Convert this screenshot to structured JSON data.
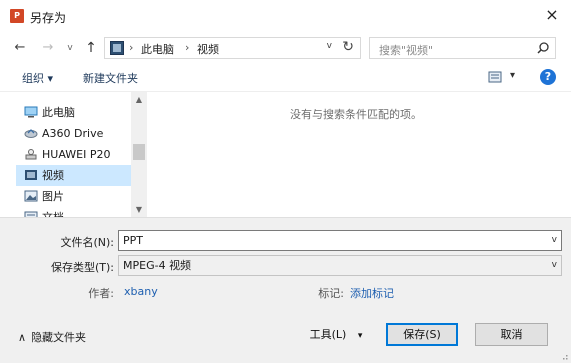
{
  "window": {
    "app_icon_text": "P",
    "title": "另存为",
    "close_glyph": "×"
  },
  "nav": {
    "back_glyph": "←",
    "forward_glyph": "→",
    "recent_glyph": "v",
    "up_glyph": "↑",
    "breadcrumb": [
      "此电脑",
      "视频"
    ],
    "separator": "›",
    "refresh_glyph": "↻",
    "dropdown_glyph": "v"
  },
  "search": {
    "placeholder": "搜索\"视频\""
  },
  "toolbar": {
    "organize_label": "组织 ▾",
    "new_folder_label": "新建文件夹",
    "view_glyph": "▾",
    "help_glyph": "?"
  },
  "sidebar": {
    "items": [
      {
        "label": "此电脑",
        "icon": "computer-icon",
        "selected": false
      },
      {
        "label": "A360 Drive",
        "icon": "cloud-drive-icon",
        "selected": false
      },
      {
        "label": "HUAWEI P20",
        "icon": "phone-icon",
        "selected": false
      },
      {
        "label": "视频",
        "icon": "video-folder-icon",
        "selected": true
      },
      {
        "label": "图片",
        "icon": "pictures-icon",
        "selected": false
      },
      {
        "label": "文档",
        "icon": "documents-icon",
        "selected": false
      }
    ]
  },
  "content": {
    "empty_message": "没有与搜索条件匹配的项。"
  },
  "form": {
    "filename_label": "文件名(N):",
    "filename_value": "PPT",
    "filetype_label": "保存类型(T):",
    "filetype_value": "MPEG-4 视频",
    "author_label": "作者:",
    "author_value": "xbany",
    "tags_label": "标记:",
    "tags_value": "添加标记"
  },
  "footer": {
    "hide_folders_label": "隐藏文件夹",
    "hide_glyph": "∧",
    "tools_label": "工具(L)",
    "tools_glyph": "▾",
    "save_label": "保存(S)",
    "cancel_label": "取消"
  },
  "colors": {
    "accent": "#0078d7",
    "link": "#1e5fb0",
    "selected_bg": "#cce8ff",
    "panel_bg": "#f0f0f0",
    "app_icon": "#d24726",
    "help_icon": "#1e73d6"
  }
}
